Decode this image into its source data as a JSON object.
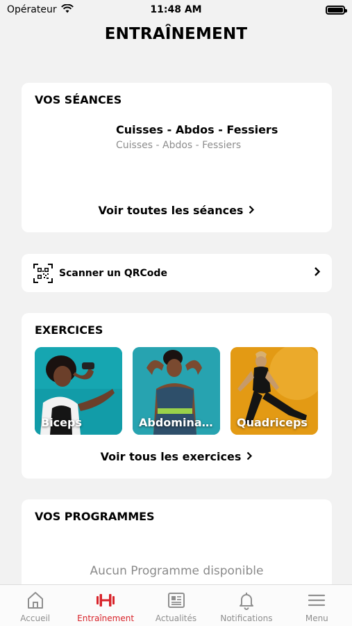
{
  "status": {
    "carrier": "Opérateur",
    "time": "11:48 AM"
  },
  "header": {
    "title": "ENTRAÎNEMENT"
  },
  "seances": {
    "title": "VOS SÉANCES",
    "item_name": "Cuisses - Abdos - Fessiers",
    "item_sub": "Cuisses - Abdos - Fessiers",
    "see_all": "Voir toutes les séances"
  },
  "qr": {
    "label": "Scanner un QRCode"
  },
  "exercices": {
    "title": "EXERCICES",
    "tiles": [
      {
        "label": "Biceps"
      },
      {
        "label": "Abdomina…"
      },
      {
        "label": "Quadriceps"
      }
    ],
    "see_all": "Voir tous les exercices"
  },
  "programmes": {
    "title": "VOS PROGRAMMES",
    "empty": "Aucun Programme disponible"
  },
  "tabbar": {
    "items": [
      {
        "label": "Accueil"
      },
      {
        "label": "Entraînement"
      },
      {
        "label": "Actualités"
      },
      {
        "label": "Notifications"
      },
      {
        "label": "Menu"
      }
    ],
    "active_color": "#d8232a",
    "inactive_color": "#8e8e8e"
  }
}
